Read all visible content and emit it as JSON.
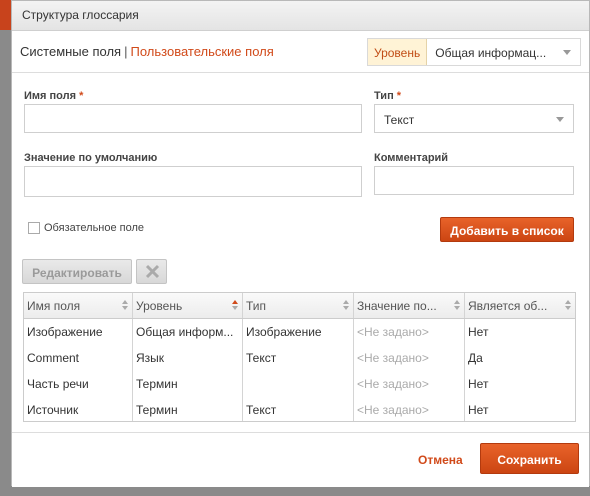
{
  "dialog": {
    "title": "Структура глоссария"
  },
  "tabs": {
    "system": "Системные поля",
    "separator": "|",
    "custom": "Пользовательские поля"
  },
  "level": {
    "label": "Уровень",
    "value": "Общая информац..."
  },
  "form": {
    "field_name_label": "Имя поля",
    "field_name_value": "",
    "required_mark": "*",
    "type_label": "Тип",
    "type_value": "Текст",
    "default_label": "Значение по умолчанию",
    "default_value": "",
    "comment_label": "Комментарий",
    "comment_value": "",
    "required_checkbox_label": "Обязательное поле",
    "required_checked": false,
    "add_button": "Добавить в список"
  },
  "toolbar": {
    "edit_button": "Редактировать",
    "delete_icon": "delete-x-icon"
  },
  "table": {
    "columns": [
      "Имя поля",
      "Уровень",
      "Тип",
      "Значение по...",
      "Является об..."
    ],
    "sorted_column": "Уровень",
    "rows": [
      [
        "Изображение",
        "Общая информ...",
        "Изображение",
        "<Не задано>",
        "Нет"
      ],
      [
        "Comment",
        "Язык",
        "Текст",
        "<Не задано>",
        "Да"
      ],
      [
        "Часть речи",
        "Термин",
        "",
        "<Не задано>",
        "Нет"
      ],
      [
        "Источник",
        "Термин",
        "Текст",
        "<Не задано>",
        "Нет"
      ]
    ]
  },
  "footer": {
    "cancel": "Отмена",
    "save": "Сохранить"
  },
  "colors": {
    "accent": "#d14a1a",
    "button": "#dc521b",
    "level_bg": "#fff3d6"
  }
}
